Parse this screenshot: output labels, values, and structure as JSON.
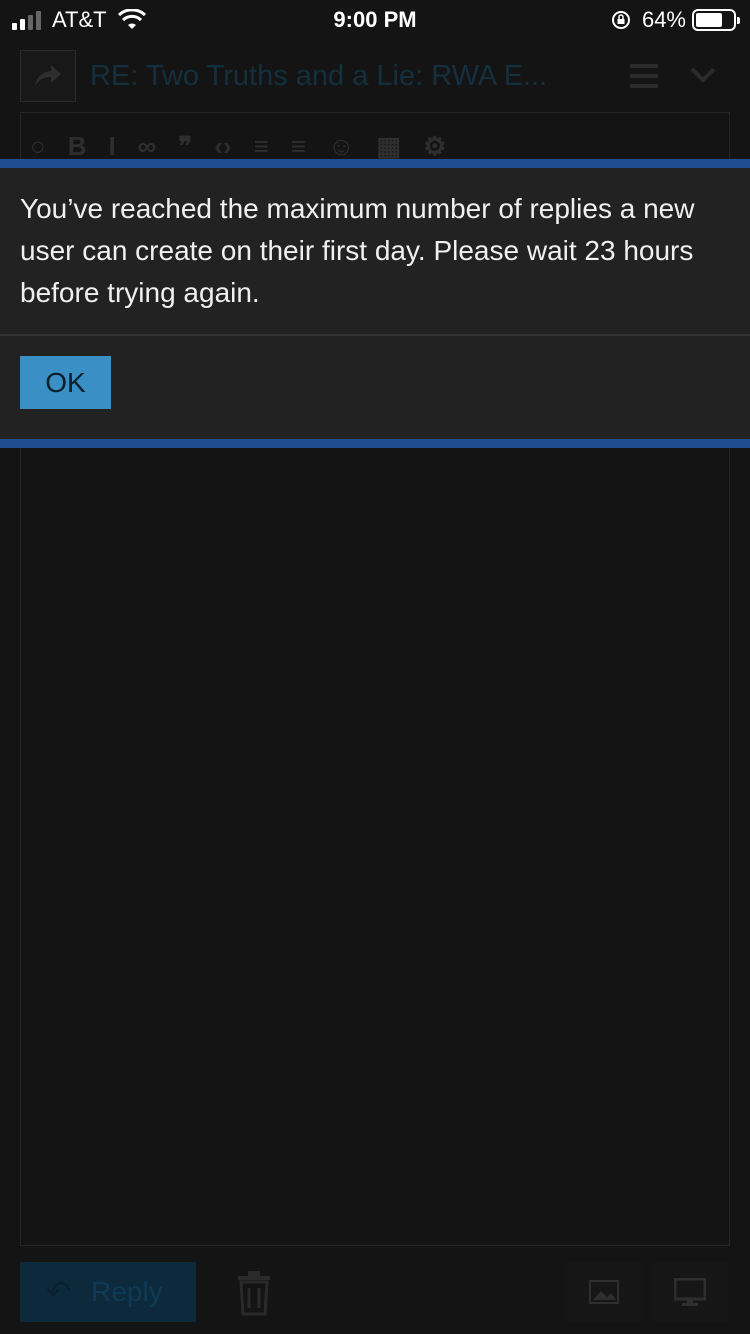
{
  "status_bar": {
    "carrier": "AT&T",
    "time": "9:00 PM",
    "battery": "64%",
    "battery_level": 0.64
  },
  "composer": {
    "title": "RE: Two Truths and a Lie: RWA E...",
    "toolbar_icons": [
      "speech-bubble-icon",
      "bold-icon",
      "italic-icon",
      "link-icon",
      "quote-icon",
      "code-icon",
      "bullet-list-icon",
      "numbered-list-icon",
      "emoji-icon",
      "calendar-icon",
      "gear-icon"
    ],
    "reply_label": "Reply"
  },
  "modal": {
    "message": "You’ve reached the maximum number of replies a new user can create on their first day. Please wait 23 hours before trying again.",
    "ok_label": "OK"
  },
  "colors": {
    "modal_border": "#1f4d8f",
    "ok_button": "#3a8fc4",
    "modal_bg": "#222222",
    "page_bg": "#141414"
  }
}
